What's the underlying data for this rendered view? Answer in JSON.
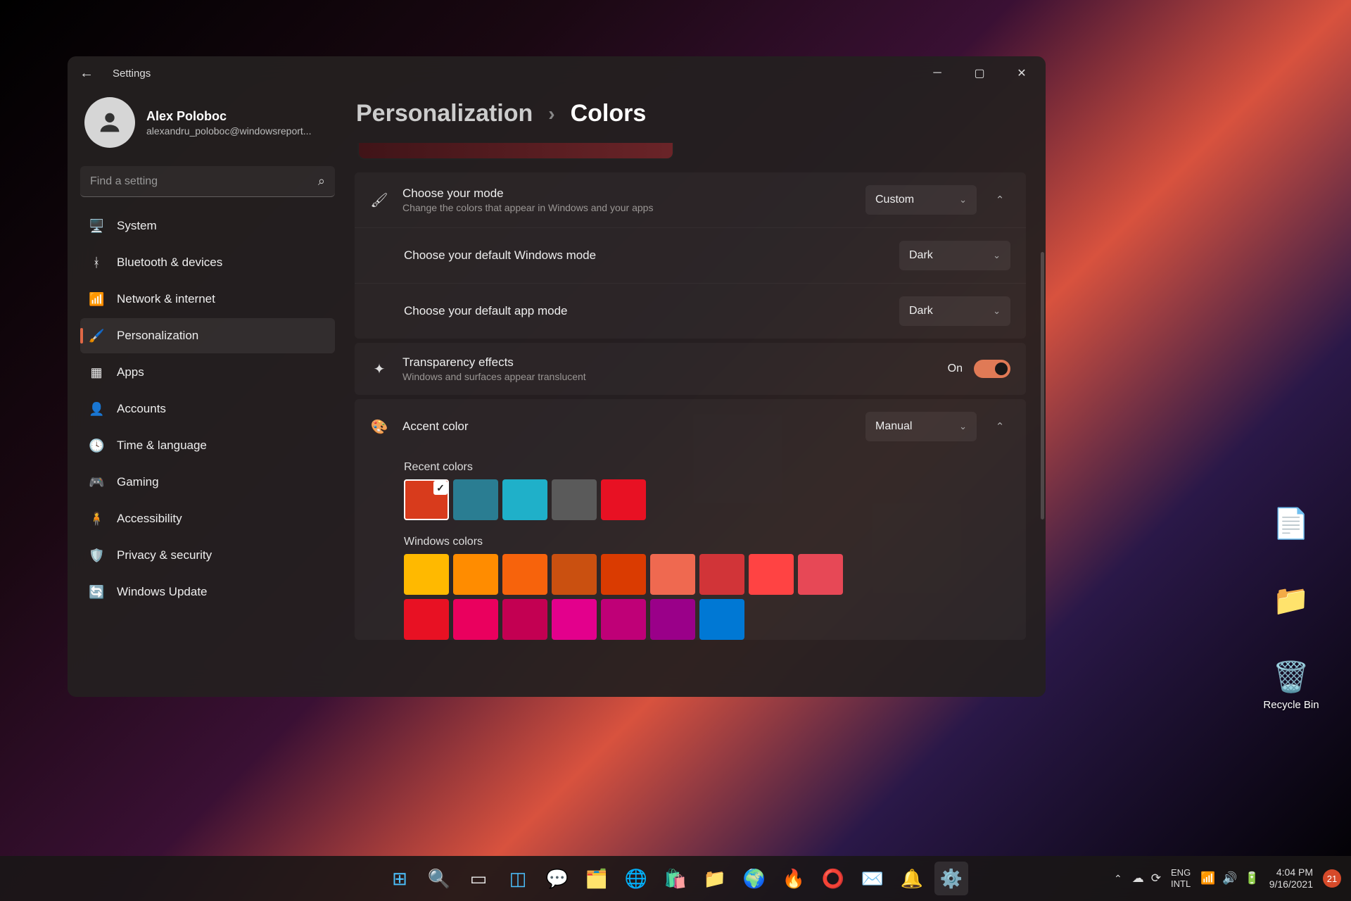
{
  "window": {
    "title": "Settings",
    "profile": {
      "name": "Alex Poloboc",
      "email": "alexandru_poloboc@windowsreport..."
    },
    "search_placeholder": "Find a setting",
    "nav": [
      {
        "label": "System",
        "icon": "🖥️"
      },
      {
        "label": "Bluetooth & devices",
        "icon": "ᚼ"
      },
      {
        "label": "Network & internet",
        "icon": "📶"
      },
      {
        "label": "Personalization",
        "icon": "🖌️",
        "active": true
      },
      {
        "label": "Apps",
        "icon": "▦"
      },
      {
        "label": "Accounts",
        "icon": "👤"
      },
      {
        "label": "Time & language",
        "icon": "🕓"
      },
      {
        "label": "Gaming",
        "icon": "🎮"
      },
      {
        "label": "Accessibility",
        "icon": "🧍"
      },
      {
        "label": "Privacy & security",
        "icon": "🛡️"
      },
      {
        "label": "Windows Update",
        "icon": "🔄"
      }
    ]
  },
  "breadcrumb": {
    "parent": "Personalization",
    "current": "Colors"
  },
  "rows": {
    "mode": {
      "title": "Choose your mode",
      "sub": "Change the colors that appear in Windows and your apps",
      "value": "Custom"
    },
    "winmode": {
      "title": "Choose your default Windows mode",
      "value": "Dark"
    },
    "appmode": {
      "title": "Choose your default app mode",
      "value": "Dark"
    },
    "transparency": {
      "title": "Transparency effects",
      "sub": "Windows and surfaces appear translucent",
      "state": "On"
    },
    "accent": {
      "title": "Accent color",
      "value": "Manual"
    }
  },
  "recent_label": "Recent colors",
  "recent_colors": [
    "#d83b1c",
    "#2a7d92",
    "#1fb0c9",
    "#5a5a5a",
    "#e81123"
  ],
  "recent_selected": 0,
  "windows_label": "Windows colors",
  "windows_colors": [
    "#ffb900",
    "#ff8c00",
    "#f7630c",
    "#ca5010",
    "#da3b01",
    "#ef6950",
    "#d13438",
    "#ff4343",
    "#e74856",
    "#e81123",
    "#ea005e",
    "#c30052",
    "#e3008c",
    "#bf0077",
    "#9a0089",
    "#0078d4"
  ],
  "desktop": {
    "recycle": "Recycle Bin"
  },
  "taskbar": {
    "lang1": "ENG",
    "lang2": "INTL",
    "time": "4:04 PM",
    "date": "9/16/2021",
    "notif": "21"
  }
}
